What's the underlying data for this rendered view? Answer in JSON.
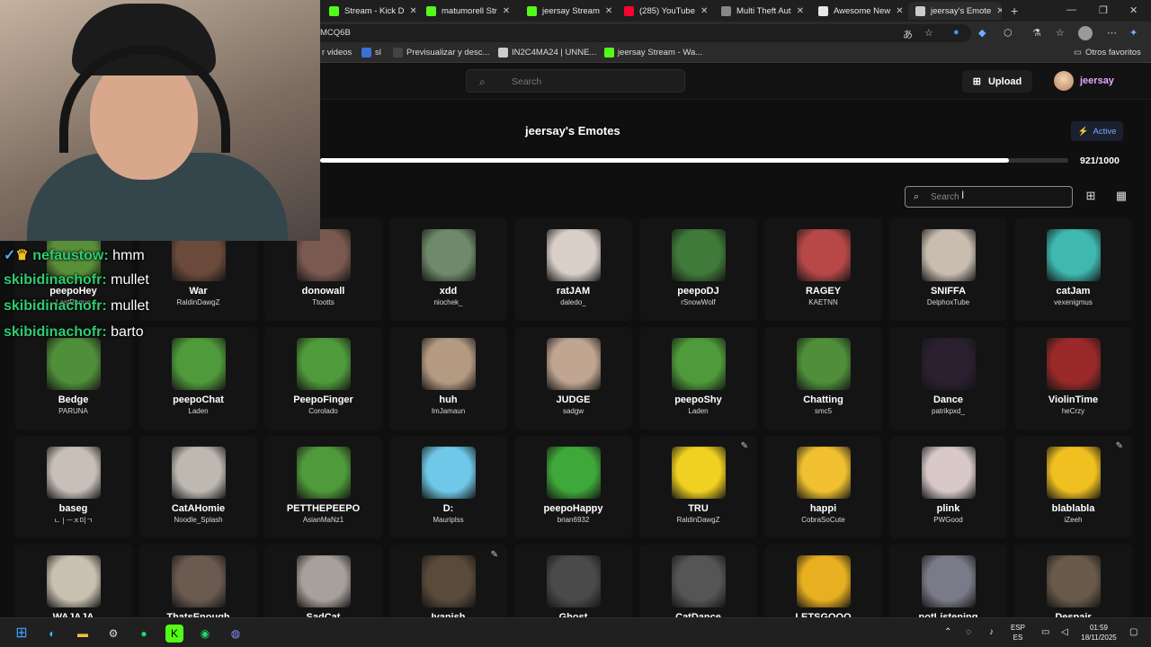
{
  "browser": {
    "tabs": [
      {
        "label": "Stream - Kick D",
        "color": "#53fc18"
      },
      {
        "label": "matumorell Str",
        "color": "#53fc18"
      },
      {
        "label": "jeersay Stream",
        "color": "#53fc18"
      },
      {
        "label": "(285) YouTube",
        "color": "#ff0033"
      },
      {
        "label": "Multi Theft Aut",
        "color": "#888888"
      },
      {
        "label": "Awesome New",
        "color": "#e8e8e8"
      },
      {
        "label": "jeersay's Emote",
        "color": "#cccccc"
      }
    ],
    "new_tab": "+",
    "url": "MCQ6B",
    "bookmarks": [
      {
        "label": "r videos"
      },
      {
        "label": "sl"
      },
      {
        "label": "Previsualizar y desc..."
      },
      {
        "label": "IN2C4MA24 | UNNE..."
      },
      {
        "label": "jeersay Stream - Wa..."
      }
    ],
    "other_bookmarks": "Otros favoritos"
  },
  "site": {
    "search_placeholder": "Search",
    "upload_label": "Upload",
    "username": "jeersay"
  },
  "set": {
    "title": "jeersay's Emotes",
    "status": "Active",
    "count_label": "921/1000",
    "used": 921,
    "capacity": 1000,
    "search_placeholder": "Search"
  },
  "emotes": [
    {
      "name": "peepoHey",
      "author": "LastRogue",
      "color": "#5a8f3a"
    },
    {
      "name": "War",
      "author": "RaldinDawgZ",
      "color": "#6b4a3c"
    },
    {
      "name": "donowall",
      "author": "Ttootts",
      "color": "#7a5a50"
    },
    {
      "name": "xdd",
      "author": "niochek_",
      "color": "#6f8a6a"
    },
    {
      "name": "ratJAM",
      "author": "daledo_",
      "color": "#d9cfc8"
    },
    {
      "name": "peepoDJ",
      "author": "rSnowWolf",
      "color": "#3f7a3a"
    },
    {
      "name": "RAGEY",
      "author": "KAETNN",
      "color": "#b84848"
    },
    {
      "name": "SNIFFA",
      "author": "DelphoxTube",
      "color": "#c9bdb0"
    },
    {
      "name": "catJam",
      "author": "vexenigmus",
      "color": "#3fb8b0"
    },
    {
      "name": "Bedge",
      "author": "PARUNA",
      "color": "#4f8f3a"
    },
    {
      "name": "peepoChat",
      "author": "Laden",
      "color": "#4f9a3a"
    },
    {
      "name": "PeepoFinger",
      "author": "Corolado",
      "color": "#4f9a3a"
    },
    {
      "name": "huh",
      "author": "ImJamaun",
      "color": "#b59a82"
    },
    {
      "name": "JUDGE",
      "author": "sadgw",
      "color": "#c0a590"
    },
    {
      "name": "peepoShy",
      "author": "Laden",
      "color": "#4f9a3a"
    },
    {
      "name": "Chatting",
      "author": "smc5",
      "color": "#4f8f3a"
    },
    {
      "name": "Dance",
      "author": "patrikpxd_",
      "color": "#2a2030"
    },
    {
      "name": "ViolinTime",
      "author": "heCrzy",
      "color": "#9a2a2a"
    },
    {
      "name": "baseg",
      "author": "ㄴ | ㅡㅈ미ㄱ",
      "color": "#c8c0b8"
    },
    {
      "name": "CatAHomie",
      "author": "Noodle_Splash",
      "color": "#bdb8b0"
    },
    {
      "name": "PETTHEPEEPO",
      "author": "AsianMaNz1",
      "color": "#4f9a3a"
    },
    {
      "name": "D:",
      "author": "Mauriplss",
      "color": "#6fc8e8"
    },
    {
      "name": "peepoHappy",
      "author": "brian6932",
      "color": "#3fa83a"
    },
    {
      "name": "TRU",
      "author": "RaldinDawgZ",
      "color": "#f0d020"
    },
    {
      "name": "happi",
      "author": "CobraSoCute",
      "color": "#f0c030"
    },
    {
      "name": "plink",
      "author": "PWGood",
      "color": "#d8c8c8"
    },
    {
      "name": "blablabla",
      "author": "iZeeh",
      "color": "#f0c020"
    },
    {
      "name": "WAJAJA",
      "author": "",
      "color": "#c8c0b0"
    },
    {
      "name": "ThatsEnough",
      "author": "",
      "color": "#6a5a50"
    },
    {
      "name": "SadCat",
      "author": "",
      "color": "#a8a09a"
    },
    {
      "name": "Ivanish",
      "author": "",
      "color": "#5a4a3a"
    },
    {
      "name": "Ghost",
      "author": "",
      "color": "#4a4a4a"
    },
    {
      "name": "CatDance",
      "author": "",
      "color": "#555555"
    },
    {
      "name": "LETSGOOO",
      "author": "",
      "color": "#e8b020"
    },
    {
      "name": "notListening",
      "author": "",
      "color": "#7a7a88"
    },
    {
      "name": "Despair",
      "author": "",
      "color": "#6a5a4a"
    }
  ],
  "chat": [
    {
      "user": "nefaustow",
      "message": "hmm"
    },
    {
      "user": "skibidinachofr",
      "message": "mullet"
    },
    {
      "user": "skibidinachofr",
      "message": "mullet"
    },
    {
      "user": "skibidinachofr",
      "message": "barto"
    }
  ],
  "taskbar": {
    "lang_top": "ESP",
    "lang_bottom": "ES",
    "time": "01:59",
    "date": "18/11/2025"
  }
}
